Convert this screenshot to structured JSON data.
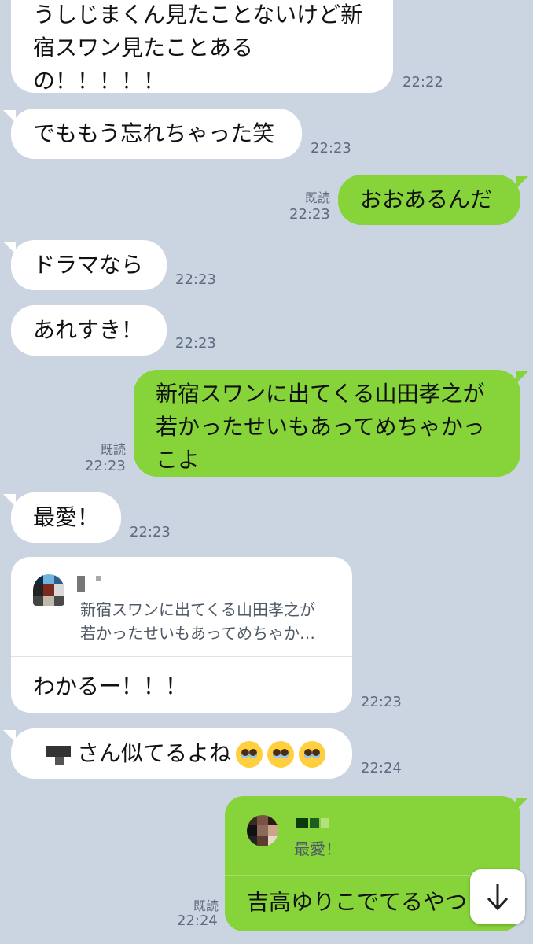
{
  "messages": [
    {
      "side": "left",
      "lines": [
        "うしじまくん見たことないけど新",
        "宿スワン見たことある",
        "の！！！！！"
      ],
      "time": "22:22"
    },
    {
      "side": "left",
      "text": "でももう忘れちゃった笑",
      "time": "22:23"
    },
    {
      "side": "right",
      "text": "おおあるんだ",
      "time": "22:23",
      "read": "既読"
    },
    {
      "side": "left",
      "text": "ドラマなら",
      "time": "22:23"
    },
    {
      "side": "left",
      "text": "あれすき！",
      "time": "22:23"
    },
    {
      "side": "right",
      "lines": [
        "新宿スワンに出てくる山田孝之が",
        "若かったせいもあってめちゃかっ",
        "こよ"
      ],
      "time": "22:23",
      "read": "既読"
    },
    {
      "side": "left",
      "text": "最愛！",
      "time": "22:23"
    },
    {
      "side": "left",
      "reply": true,
      "quote_lines": [
        "新宿スワンに出てくる山田孝之が",
        "若かったせいもあってめちゃか…"
      ],
      "text": "わかるー！！！",
      "time": "22:23"
    },
    {
      "side": "left",
      "text": "さん似てるよね",
      "emoji_count": 3,
      "time": "22:24"
    },
    {
      "side": "right",
      "reply": true,
      "quote_text": "最愛！",
      "text": "吉高ゆりこでてるやつ",
      "time": "22:24",
      "read": "既読"
    }
  ],
  "scroll_button": {
    "icon": "arrow-down-icon"
  },
  "colors": {
    "background": "#cbd5e1",
    "incoming": "#ffffff",
    "outgoing": "#86d33a"
  }
}
